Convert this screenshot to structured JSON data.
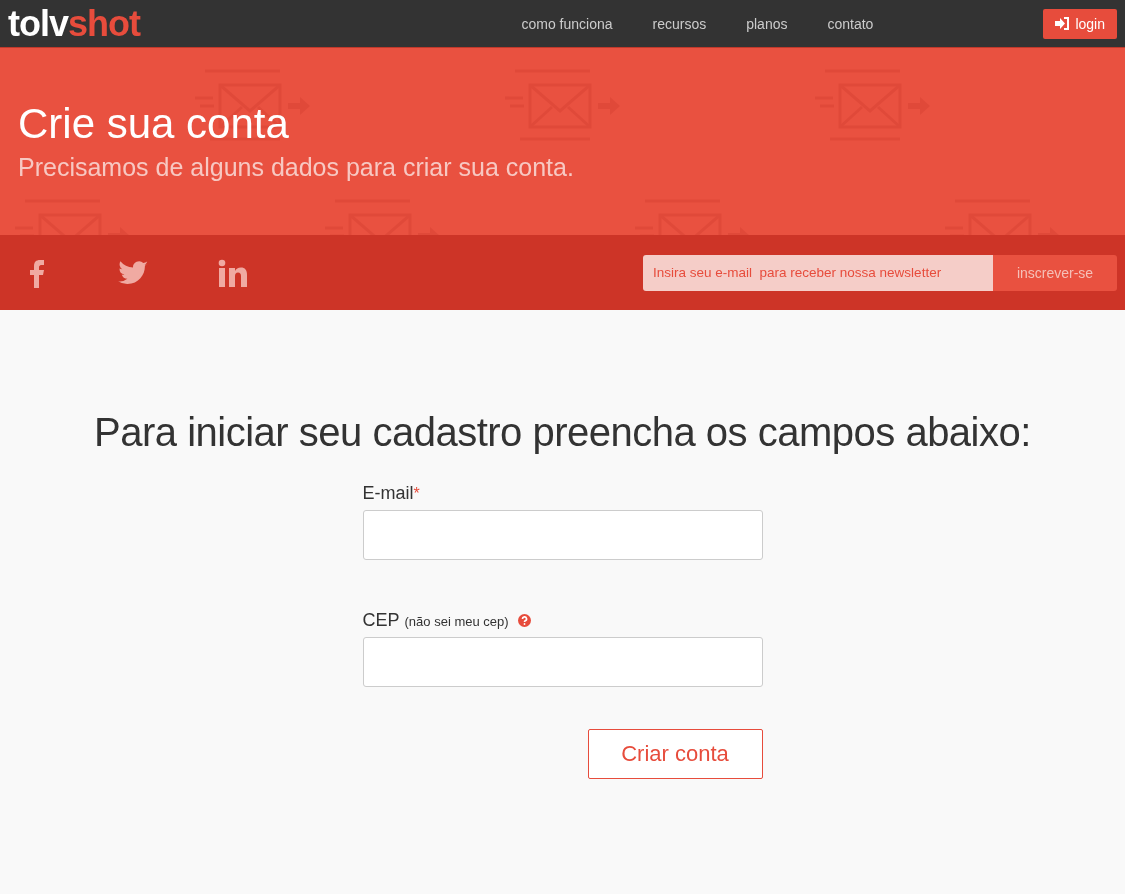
{
  "logo": {
    "part_1": "tolv",
    "part_2": "shot"
  },
  "nav": {
    "links": [
      "como funciona",
      "recursos",
      "planos",
      "contato"
    ],
    "login": "login"
  },
  "hero": {
    "title": "Crie sua conta",
    "subtitle": "Precisamos de alguns dados para criar sua conta."
  },
  "social": {
    "icons": [
      {
        "kind": "facebook"
      },
      {
        "kind": "twitter"
      },
      {
        "kind": "linkedin"
      }
    ]
  },
  "newsletter": {
    "placeholder": "Insira seu e-mail  para receber nossa newsletter",
    "button": "inscrever-se"
  },
  "form": {
    "heading": "Para iniciar seu cadastro preencha os campos abaixo:",
    "fields": [
      {
        "label": "E-mail",
        "required_mark": "*"
      },
      {
        "label": "CEP",
        "hint": "(não sei meu cep)",
        "help": true
      }
    ],
    "submit": "Criar conta"
  }
}
